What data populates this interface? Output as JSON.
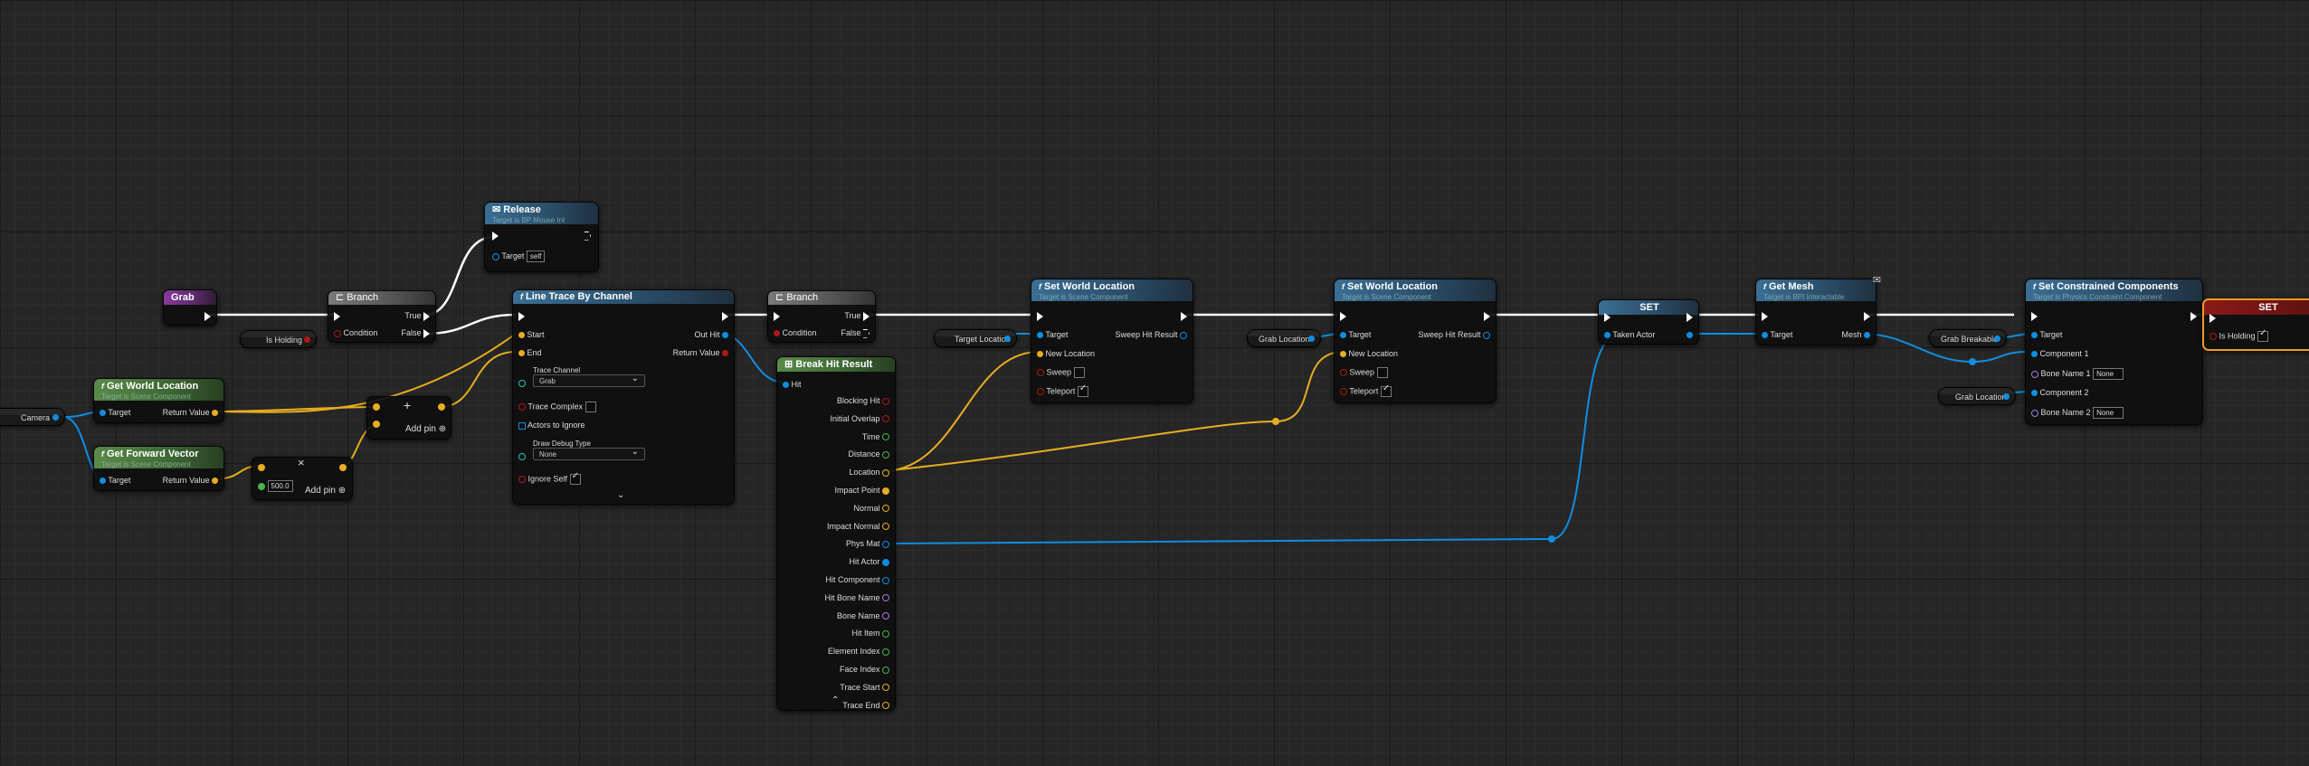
{
  "colors": {
    "exec": "#ffffff",
    "object": "#0f8ee0",
    "vector": "#e8ad20",
    "bool": "#b01818",
    "float": "#49b54b",
    "name": "#a67adf",
    "struct": "#1ec8c0"
  },
  "grab_event": {
    "title": "Grab"
  },
  "is_holding_var": {
    "label": "Is Holding"
  },
  "branch1": {
    "title": "Branch",
    "condition": "Condition",
    "true": "True",
    "false": "False"
  },
  "release": {
    "title": "Release",
    "subtitle": "Target is BP Mouse Int",
    "target": "Target",
    "target_value": "self"
  },
  "camera_var": {
    "label": "Camera"
  },
  "get_world_location": {
    "title": "Get World Location",
    "subtitle": "Target is Scene Component",
    "target": "Target",
    "return": "Return Value"
  },
  "get_forward_vector": {
    "title": "Get Forward Vector",
    "subtitle": "Target is Scene Component",
    "target": "Target",
    "return": "Return Value"
  },
  "add1": {
    "add_pin": "Add pin"
  },
  "mult": {
    "value": "500.0",
    "add_pin": "Add pin"
  },
  "line_trace": {
    "title": "Line Trace By Channel",
    "start": "Start",
    "end": "End",
    "trace_channel": "Trace Channel",
    "trace_channel_value": "Grab",
    "trace_complex": "Trace Complex",
    "actors_to_ignore": "Actors to Ignore",
    "draw_debug_type": "Draw Debug Type",
    "draw_debug_value": "None",
    "ignore_self": "Ignore Self",
    "out_hit": "Out Hit",
    "return": "Return Value"
  },
  "branch2": {
    "title": "Branch",
    "condition": "Condition",
    "true": "True",
    "false": "False"
  },
  "break_hit": {
    "title": "Break Hit Result",
    "hit": "Hit",
    "outputs": [
      "Blocking Hit",
      "Initial Overlap",
      "Time",
      "Distance",
      "Location",
      "Impact Point",
      "Normal",
      "Impact Normal",
      "Phys Mat",
      "Hit Actor",
      "Hit Component",
      "Hit Bone Name",
      "Bone Name",
      "Hit Item",
      "Element Index",
      "Face Index",
      "Trace Start",
      "Trace End"
    ]
  },
  "target_location_var": {
    "label": "Target Location"
  },
  "set_world_location1": {
    "title": "Set World Location",
    "subtitle": "Target is Scene Component",
    "target": "Target",
    "new_location": "New Location",
    "sweep": "Sweep",
    "teleport": "Teleport",
    "sweep_hit": "Sweep Hit Result"
  },
  "grab_location_var1": {
    "label": "Grab Location"
  },
  "set_world_location2": {
    "title": "Set World Location",
    "subtitle": "Target is Scene Component",
    "target": "Target",
    "new_location": "New Location",
    "sweep": "Sweep",
    "teleport": "Teleport",
    "sweep_hit": "Sweep Hit Result"
  },
  "set_taken": {
    "title": "SET",
    "pin": "Taken Actor"
  },
  "get_mesh": {
    "title": "Get Mesh",
    "subtitle": "Target is BPI Interactable",
    "target": "Target",
    "mesh": "Mesh"
  },
  "grab_breakable_var": {
    "label": "Grab Breakable"
  },
  "grab_location_var2": {
    "label": "Grab Location"
  },
  "set_constrained": {
    "title": "Set Constrained Components",
    "subtitle": "Target is Physics Constraint Component",
    "target": "Target",
    "comp1": "Component 1",
    "bone1": "Bone Name 1",
    "bone1_value": "None",
    "comp2": "Component 2",
    "bone2": "Bone Name 2",
    "bone2_value": "None"
  },
  "set_holding": {
    "title": "SET",
    "pin": "Is Holding"
  }
}
